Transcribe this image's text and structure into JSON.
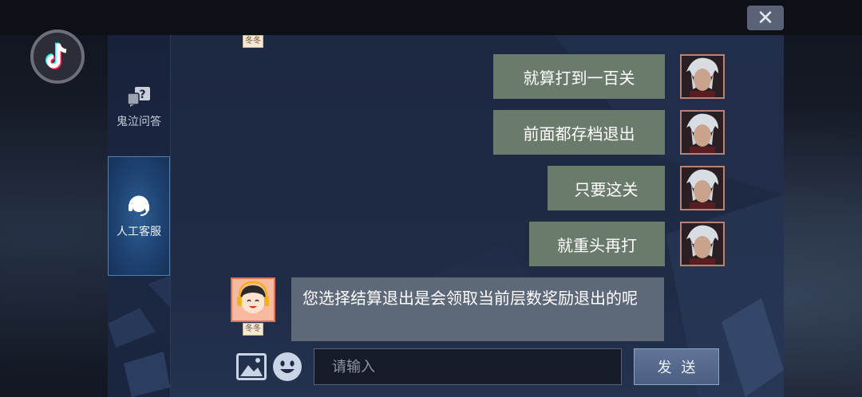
{
  "app": {
    "logo_icon": "tiktok-icon",
    "close_icon": "close-icon",
    "close_symbol": "✕"
  },
  "sidebar": {
    "items": [
      {
        "label": "鬼泣问答",
        "icon": "question-bubble-icon",
        "active": false
      },
      {
        "label": "人工客服",
        "icon": "headset-icon",
        "active": true
      }
    ]
  },
  "chat": {
    "agent_nickname": "冬冬",
    "messages": [
      {
        "from": "user",
        "text": "就算打到一百关"
      },
      {
        "from": "user",
        "text": "前面都存档退出"
      },
      {
        "from": "user",
        "text": "只要这关"
      },
      {
        "from": "user",
        "text": "就重头再打"
      },
      {
        "from": "agent",
        "text": "您选择结算退出是会领取当前层数奖励退出的呢"
      }
    ]
  },
  "composer": {
    "placeholder": "请输入",
    "value": "",
    "send_label": "发送",
    "image_icon": "image-icon",
    "emoji_icon": "emoji-icon"
  },
  "colors": {
    "user_bubble": "#6a7a6b",
    "agent_bubble": "#5d6878",
    "chat_bg": "#1f2a44",
    "active_tab": "#1e4272"
  }
}
